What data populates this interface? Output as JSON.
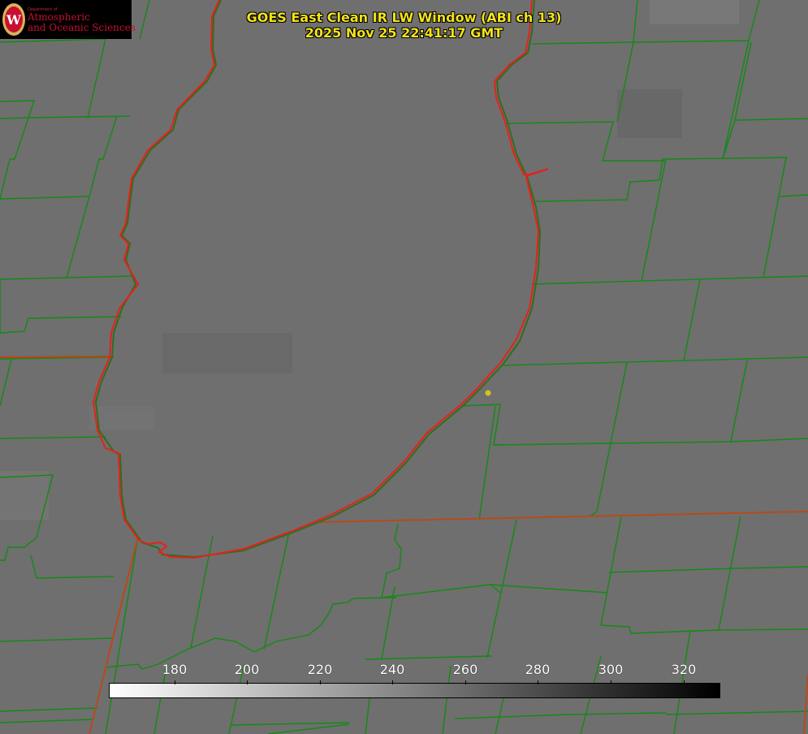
{
  "product": {
    "title_line1": "GOES East Clean IR LW Window (ABI ch 13)",
    "title_line2": "2025 Nov 25 22:41:17 GMT"
  },
  "logo": {
    "department": "Department of",
    "line1": "Atmospheric",
    "line2": "and Oceanic Sciences",
    "seal_letter": "W"
  },
  "colorbar": {
    "tick_labels": [
      "180",
      "200",
      "220",
      "240",
      "260",
      "280",
      "300",
      "320"
    ],
    "gradient": "white-to-black"
  },
  "colors": {
    "title": "#f2e21a",
    "coastline": "#e8201a",
    "county_lines": "#138a13",
    "marker": "#d8c21a",
    "background": "#6f6f6f"
  },
  "map": {
    "feature": "lake outline with county boundaries",
    "marker": "yellow dot"
  }
}
